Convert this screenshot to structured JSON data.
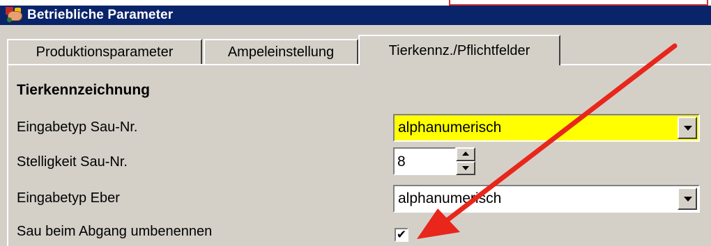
{
  "window": {
    "title": "Betriebliche Parameter",
    "icon": "app-pig-icon"
  },
  "tabs": [
    {
      "label": "Produktionsparameter",
      "active": false
    },
    {
      "label": "Ampeleinstellung",
      "active": false
    },
    {
      "label": "Tierkennz./Pflichtfelder",
      "active": true
    }
  ],
  "section": {
    "title": "Tierkennzeichnung"
  },
  "fields": {
    "eingabetyp_sau": {
      "label": "Eingabetyp Sau-Nr.",
      "value": "alphanumerisch",
      "highlight_color": "#ffff00"
    },
    "stelligkeit_sau": {
      "label": "Stelligkeit Sau-Nr.",
      "value": "8"
    },
    "eingabetyp_eber": {
      "label": "Eingabetyp Eber",
      "value": "alphanumerisch"
    },
    "umbenennen": {
      "label": "Sau beim Abgang umbenennen",
      "checked": true,
      "check_glyph": "✔"
    }
  },
  "annotation": {
    "arrow_color": "#e8261c",
    "callout_color": "#d83030"
  }
}
